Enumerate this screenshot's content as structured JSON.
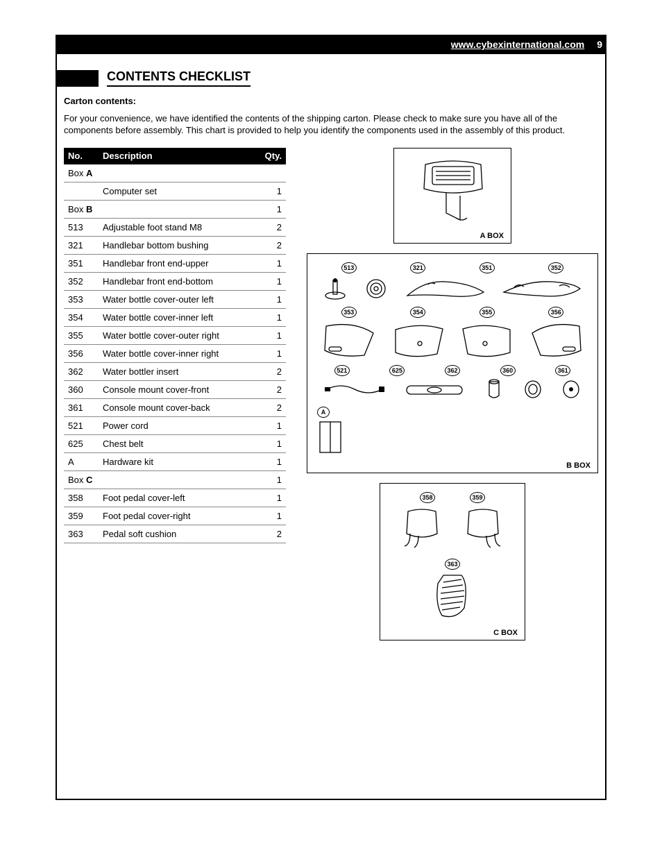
{
  "header": {
    "url": "www.cybexinternational.com",
    "page_number": "9"
  },
  "title": "CONTENTS CHECKLIST",
  "subhead_label": "Carton contents",
  "intro_text": "For your convenience, we have identified the contents of the shipping carton.  Please check to make sure you have all of the components before assembly.  This chart is provided to help you identify the components used in the assembly of this product.",
  "table": {
    "headers": {
      "no": "No.",
      "desc": "Description",
      "qty": "Qty."
    },
    "rows": [
      {
        "type": "box",
        "no_prefix": "Box ",
        "no_bold": "A",
        "desc": "",
        "qty": ""
      },
      {
        "type": "item",
        "no": "",
        "desc": "Computer set",
        "qty": "1"
      },
      {
        "type": "box",
        "no_prefix": "Box ",
        "no_bold": "B",
        "desc": "",
        "qty": "1"
      },
      {
        "type": "item",
        "no": "513",
        "desc": "Adjustable foot stand M8",
        "qty": "2"
      },
      {
        "type": "item",
        "no": "321",
        "desc": "Handlebar bottom bushing",
        "qty": "2"
      },
      {
        "type": "item",
        "no": "351",
        "desc": "Handlebar front end-upper",
        "qty": "1"
      },
      {
        "type": "item",
        "no": "352",
        "desc": "Handlebar front end-bottom",
        "qty": "1"
      },
      {
        "type": "item",
        "no": "353",
        "desc": "Water bottle cover-outer left",
        "qty": "1"
      },
      {
        "type": "item",
        "no": "354",
        "desc": "Water bottle cover-inner left",
        "qty": "1"
      },
      {
        "type": "item",
        "no": "355",
        "desc": "Water bottle cover-outer right",
        "qty": "1"
      },
      {
        "type": "item",
        "no": "356",
        "desc": "Water bottle cover-inner right",
        "qty": "1"
      },
      {
        "type": "item",
        "no": "362",
        "desc": "Water bottler insert",
        "qty": "2"
      },
      {
        "type": "item",
        "no": "360",
        "desc": "Console mount cover-front",
        "qty": "2"
      },
      {
        "type": "item",
        "no": "361",
        "desc": "Console mount cover-back",
        "qty": "2"
      },
      {
        "type": "item",
        "no": "521",
        "desc": "Power cord",
        "qty": "1"
      },
      {
        "type": "item",
        "no": "625",
        "desc": "Chest belt",
        "qty": "1"
      },
      {
        "type": "item",
        "no": "A",
        "desc": "Hardware kit",
        "qty": "1"
      },
      {
        "type": "box",
        "no_prefix": "Box ",
        "no_bold": "C",
        "desc": "",
        "qty": "1"
      },
      {
        "type": "item",
        "no": "358",
        "desc": "Foot pedal cover-left",
        "qty": "1"
      },
      {
        "type": "item",
        "no": "359",
        "desc": "Foot pedal cover-right",
        "qty": "1"
      },
      {
        "type": "item",
        "no": "363",
        "desc": "Pedal soft cushion",
        "qty": "2"
      }
    ]
  },
  "diagrams": {
    "a_box": {
      "caption": "A BOX"
    },
    "b_box": {
      "caption": "B BOX",
      "row1_callouts": [
        "513",
        "321",
        "351",
        "352"
      ],
      "row2_callouts": [
        "353",
        "354",
        "355",
        "356"
      ],
      "row3_callouts": [
        "521",
        "625",
        "362",
        "360",
        "361"
      ],
      "hw_callout": "A"
    },
    "c_box": {
      "caption": "C BOX",
      "top_callouts": [
        "358",
        "359"
      ],
      "bottom_callout": "363"
    }
  }
}
